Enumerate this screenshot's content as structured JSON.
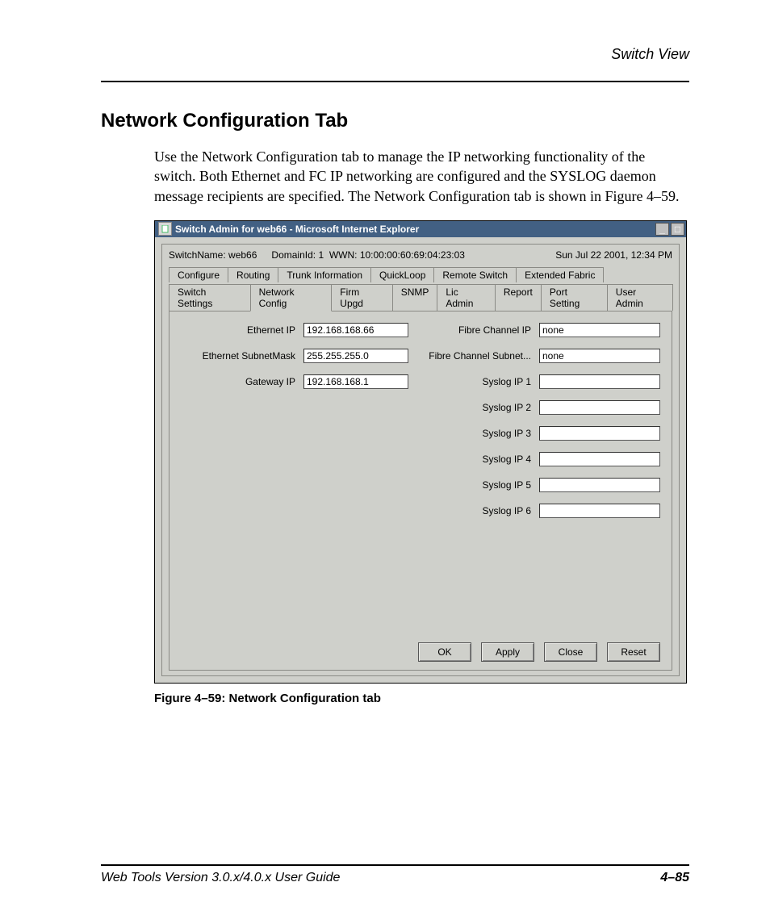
{
  "header": {
    "section": "Switch View"
  },
  "heading": "Network Configuration Tab",
  "paragraph": "Use the Network Configuration tab to manage the IP networking functionality of the switch. Both Ethernet and FC IP networking are configured and the SYSLOG daemon message recipients are specified. The Network Configuration tab is shown in Figure 4–59.",
  "window": {
    "title": "Switch Admin for web66 - Microsoft Internet Explorer",
    "status": {
      "switch_name_label": "SwitchName:",
      "switch_name": "web66",
      "domain_label": "DomainId:",
      "domain": "1",
      "wwn_label": "WWN:",
      "wwn": "10:00:00:60:69:04:23:03",
      "datetime": "Sun Jul 22  2001, 12:34 PM"
    },
    "tabs_row1": [
      "Configure",
      "Routing",
      "Trunk Information",
      "QuickLoop",
      "Remote Switch",
      "Extended Fabric"
    ],
    "tabs_row2": [
      "Switch Settings",
      "Network Config",
      "Firm Upgd",
      "SNMP",
      "Lic Admin",
      "Report",
      "Port Setting",
      "User Admin"
    ],
    "active_tab": "Network Config",
    "fields": {
      "ethernet_ip": {
        "label": "Ethernet IP",
        "value": "192.168.168.66"
      },
      "ethernet_subnet": {
        "label": "Ethernet SubnetMask",
        "value": "255.255.255.0"
      },
      "gateway_ip": {
        "label": "Gateway IP",
        "value": "192.168.168.1"
      },
      "fc_ip": {
        "label": "Fibre Channel IP",
        "value": "none"
      },
      "fc_subnet": {
        "label": "Fibre Channel Subnet...",
        "value": "none"
      },
      "syslog1": {
        "label": "Syslog IP 1",
        "value": ""
      },
      "syslog2": {
        "label": "Syslog IP 2",
        "value": ""
      },
      "syslog3": {
        "label": "Syslog IP 3",
        "value": ""
      },
      "syslog4": {
        "label": "Syslog IP 4",
        "value": ""
      },
      "syslog5": {
        "label": "Syslog IP 5",
        "value": ""
      },
      "syslog6": {
        "label": "Syslog IP 6",
        "value": ""
      }
    },
    "buttons": {
      "ok": "OK",
      "apply": "Apply",
      "close": "Close",
      "reset": "Reset"
    },
    "sysbtns": {
      "min": "_",
      "max": "□"
    }
  },
  "figure_caption": "Figure 4–59:  Network Configuration tab",
  "footer": {
    "left": "Web Tools Version 3.0.x/4.0.x User Guide",
    "right": "4–85"
  }
}
